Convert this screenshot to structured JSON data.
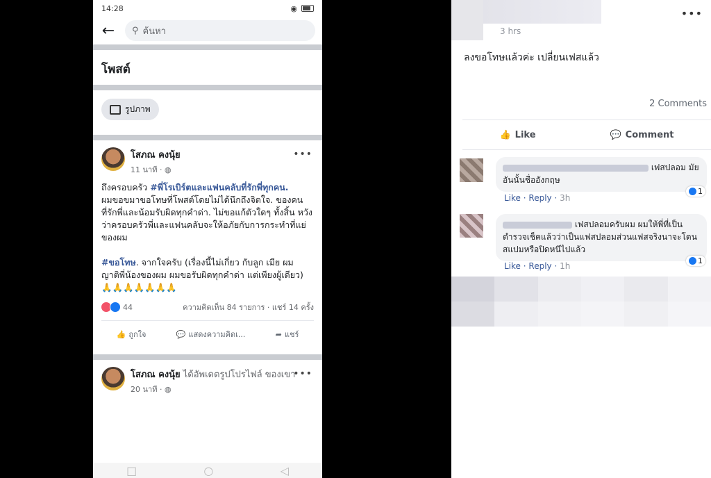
{
  "left": {
    "status": {
      "time": "14:28",
      "signal": "ᵛᴼˡ 吊"
    },
    "search": {
      "placeholder": "ค้นหา"
    },
    "section_title": "โพสต์",
    "filter_chip": "รูปภาพ",
    "post1": {
      "author": "โสภณ คงนุ้ย",
      "time": "11 นาที · ",
      "line1": "ถึงครอบครัว ",
      "hashtag1": "#พี่โรเบิร์ตและแฟนคลับที่รักพี่ทุกคน.",
      "para1": "ผมขอขมาขอโทษที่โพสต์โดยไม่ได้นึกถึงจิตใจ. ของคนที่รักพี่และน้อมรับผิดทุกคำด่า. ไม่ขอแก้ตัวใดๆ ทั้งสิ้น หวังว่าครอบครัวพี่และแฟนคลับจะให้อภัยกับการกระทำที่แย่ของผม",
      "hashtag2": "#ขอโทษ",
      "para2": ". จากใจครับ (เรื่องนี้ไม่เกี่ยว กับลูก เมีย ผม ญาติพี่น้องของผม ผมขอรับผิดทุกคำด่า แต่เพียงผู้เดียว)",
      "emoji": "🙏🙏🙏🙏🙏🙏🙏",
      "reaction_count": "44",
      "stats": "ความคิดเห็น 84 รายการ · แชร์ 14 ครั้ง",
      "actions": {
        "like": "ถูกใจ",
        "comment": "แสดงความคิดเ...",
        "share": "แชร์"
      }
    },
    "post2": {
      "author": "โสภณ คงนุ้ย",
      "activity": " ได้อัพเดตรูปโปรไฟล์ ของเขา",
      "time": "20 นาที · "
    }
  },
  "right": {
    "time": "3 hrs",
    "text": "ลงขอโทษแล้วค่ะ เปลี่ยนเฟสแล้ว",
    "comment_count": "2 Comments",
    "actions": {
      "like": "Like",
      "comment": "Comment"
    },
    "comments": [
      {
        "text": "เฟสปลอม มัย อันนั้นชื่ออังกฤษ",
        "like": "Like",
        "reply": "Reply",
        "time": "3h",
        "reactions": "1"
      },
      {
        "text": "เฟสปลอมครับผม ผมให้พี่ที่เป็นตำรวจเช็คแล้วว่าเป็นแฟสปลอมส่วนแฟสจริงนาจะโดนสแปมหรือปิดหนีไปแล้ว",
        "like": "Like",
        "reply": "Reply",
        "time": "1h",
        "reactions": "1"
      }
    ]
  },
  "colors": {
    "link": "#385898",
    "like_blue": "#1877f2",
    "angry": "#f25268"
  }
}
